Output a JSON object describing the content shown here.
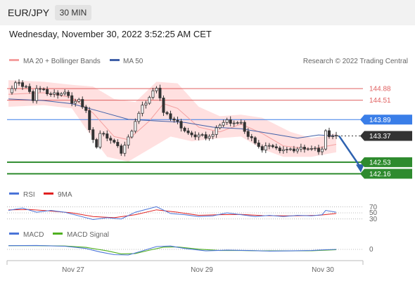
{
  "header": {
    "symbol": "EUR/JPY",
    "timeframe_label": "30 MIN",
    "timestamp": "Wednesday, November 30, 2022 3:52:25 AM CET"
  },
  "credit": "Research © 2022 Trading Central",
  "colors": {
    "price": "#333333",
    "bollinger": "#ffd6d6",
    "ma20": "#f4a0a0",
    "ma50": "#4060a8",
    "resistance": "#e06060",
    "pivot": "#3a7ee8",
    "support": "#2e8b2e",
    "current": "#333333",
    "rsi": "#4a74d8",
    "rsi_ma": "#e02020",
    "macd": "#4a74d8",
    "macd_signal": "#50b020",
    "projection_arrow": "#2e62b0"
  },
  "chart_data": [
    {
      "type": "candlestick",
      "title": "EUR/JPY",
      "interval": "30 MIN",
      "x_ticks": [
        "Nov 27",
        "Nov 29",
        "Nov 30"
      ],
      "ylim": [
        141.9,
        145.4
      ],
      "legend": [
        "MA 20 + Bollinger Bands",
        "MA 50"
      ],
      "current_price": 143.37,
      "current_price_label": "143.37",
      "levels": [
        {
          "name": "resistance-2",
          "value": 144.88,
          "label": "144.88",
          "role": "resistance",
          "tagged": false
        },
        {
          "name": "resistance-1",
          "value": 144.51,
          "label": "144.51",
          "role": "resistance",
          "tagged": false
        },
        {
          "name": "pivot",
          "value": 143.89,
          "label": "143.89",
          "role": "pivot",
          "tagged": true
        },
        {
          "name": "support-1",
          "value": 142.53,
          "label": "142.53",
          "role": "support",
          "tagged": true
        },
        {
          "name": "support-2",
          "value": 142.16,
          "label": "142.16",
          "role": "support",
          "tagged": true
        }
      ],
      "projection": {
        "from": 143.37,
        "to": 142.16,
        "direction": "down"
      },
      "close_path": [
        {
          "t": 0,
          "v": 144.75
        },
        {
          "t": 2,
          "v": 145.05
        },
        {
          "t": 5,
          "v": 144.95
        },
        {
          "t": 7,
          "v": 144.55
        },
        {
          "t": 8,
          "v": 144.9
        },
        {
          "t": 12,
          "v": 144.7
        },
        {
          "t": 16,
          "v": 144.75
        },
        {
          "t": 18,
          "v": 144.45
        },
        {
          "t": 20,
          "v": 144.5
        },
        {
          "t": 22,
          "v": 144.2
        },
        {
          "t": 23,
          "v": 143.55
        },
        {
          "t": 24,
          "v": 143.2
        },
        {
          "t": 25,
          "v": 143.05
        },
        {
          "t": 26,
          "v": 143.45
        },
        {
          "t": 28,
          "v": 143.35
        },
        {
          "t": 30,
          "v": 143.15
        },
        {
          "t": 32,
          "v": 142.85
        },
        {
          "t": 34,
          "v": 143.3
        },
        {
          "t": 36,
          "v": 143.85
        },
        {
          "t": 38,
          "v": 144.3
        },
        {
          "t": 40,
          "v": 144.6
        },
        {
          "t": 42,
          "v": 144.95
        },
        {
          "t": 43,
          "v": 144.6
        },
        {
          "t": 44,
          "v": 144.1
        },
        {
          "t": 46,
          "v": 143.95
        },
        {
          "t": 48,
          "v": 143.8
        },
        {
          "t": 50,
          "v": 143.55
        },
        {
          "t": 52,
          "v": 143.35
        },
        {
          "t": 54,
          "v": 143.4
        },
        {
          "t": 56,
          "v": 143.35
        },
        {
          "t": 58,
          "v": 143.4
        },
        {
          "t": 60,
          "v": 143.75
        },
        {
          "t": 62,
          "v": 143.85
        },
        {
          "t": 64,
          "v": 143.8
        },
        {
          "t": 66,
          "v": 143.75
        },
        {
          "t": 68,
          "v": 143.35
        },
        {
          "t": 70,
          "v": 143.2
        },
        {
          "t": 72,
          "v": 142.9
        },
        {
          "t": 74,
          "v": 143.1
        },
        {
          "t": 76,
          "v": 142.95
        },
        {
          "t": 78,
          "v": 142.95
        },
        {
          "t": 80,
          "v": 142.9
        },
        {
          "t": 82,
          "v": 142.95
        },
        {
          "t": 84,
          "v": 143.0
        },
        {
          "t": 86,
          "v": 142.95
        },
        {
          "t": 88,
          "v": 142.9
        },
        {
          "t": 89,
          "v": 142.95
        },
        {
          "t": 90,
          "v": 143.5
        },
        {
          "t": 91,
          "v": 143.4
        },
        {
          "t": 93,
          "v": 143.37
        }
      ],
      "ma20": [
        {
          "t": 0,
          "v": 144.7
        },
        {
          "t": 10,
          "v": 144.75
        },
        {
          "t": 18,
          "v": 144.6
        },
        {
          "t": 24,
          "v": 144.1
        },
        {
          "t": 30,
          "v": 143.35
        },
        {
          "t": 34,
          "v": 143.25
        },
        {
          "t": 40,
          "v": 143.85
        },
        {
          "t": 44,
          "v": 144.4
        },
        {
          "t": 48,
          "v": 144.25
        },
        {
          "t": 54,
          "v": 143.65
        },
        {
          "t": 60,
          "v": 143.5
        },
        {
          "t": 66,
          "v": 143.75
        },
        {
          "t": 72,
          "v": 143.45
        },
        {
          "t": 78,
          "v": 143.05
        },
        {
          "t": 86,
          "v": 142.95
        },
        {
          "t": 93,
          "v": 143.1
        }
      ],
      "ma50": [
        {
          "t": 0,
          "v": 144.55
        },
        {
          "t": 10,
          "v": 144.5
        },
        {
          "t": 18,
          "v": 144.4
        },
        {
          "t": 26,
          "v": 144.15
        },
        {
          "t": 34,
          "v": 143.9
        },
        {
          "t": 42,
          "v": 143.85
        },
        {
          "t": 50,
          "v": 143.8
        },
        {
          "t": 58,
          "v": 143.65
        },
        {
          "t": 66,
          "v": 143.6
        },
        {
          "t": 74,
          "v": 143.45
        },
        {
          "t": 82,
          "v": 143.3
        },
        {
          "t": 88,
          "v": 143.4
        },
        {
          "t": 93,
          "v": 143.37
        }
      ],
      "bollinger_upper": [
        {
          "t": 0,
          "v": 145.15
        },
        {
          "t": 10,
          "v": 145.1
        },
        {
          "t": 18,
          "v": 145.0
        },
        {
          "t": 24,
          "v": 144.95
        },
        {
          "t": 30,
          "v": 144.55
        },
        {
          "t": 36,
          "v": 144.45
        },
        {
          "t": 42,
          "v": 145.1
        },
        {
          "t": 48,
          "v": 145.05
        },
        {
          "t": 54,
          "v": 144.3
        },
        {
          "t": 60,
          "v": 144.0
        },
        {
          "t": 66,
          "v": 144.05
        },
        {
          "t": 72,
          "v": 143.95
        },
        {
          "t": 80,
          "v": 143.5
        },
        {
          "t": 86,
          "v": 143.3
        },
        {
          "t": 93,
          "v": 143.45
        }
      ],
      "bollinger_lower": [
        {
          "t": 0,
          "v": 144.3
        },
        {
          "t": 10,
          "v": 144.35
        },
        {
          "t": 18,
          "v": 144.25
        },
        {
          "t": 22,
          "v": 143.6
        },
        {
          "t": 28,
          "v": 142.7
        },
        {
          "t": 34,
          "v": 142.55
        },
        {
          "t": 40,
          "v": 142.95
        },
        {
          "t": 46,
          "v": 143.35
        },
        {
          "t": 52,
          "v": 143.2
        },
        {
          "t": 60,
          "v": 143.3
        },
        {
          "t": 66,
          "v": 143.35
        },
        {
          "t": 72,
          "v": 142.95
        },
        {
          "t": 78,
          "v": 142.7
        },
        {
          "t": 86,
          "v": 142.7
        },
        {
          "t": 93,
          "v": 142.85
        }
      ]
    },
    {
      "type": "line",
      "title": "RSI",
      "legend": [
        "RSI",
        "9MA"
      ],
      "levels": [
        70,
        50,
        30
      ],
      "level_labels": [
        "70",
        "50",
        "30"
      ],
      "ylim": [
        20,
        80
      ],
      "rsi": [
        {
          "t": 0,
          "v": 58
        },
        {
          "t": 4,
          "v": 66
        },
        {
          "t": 8,
          "v": 52
        },
        {
          "t": 12,
          "v": 58
        },
        {
          "t": 16,
          "v": 52
        },
        {
          "t": 20,
          "v": 40
        },
        {
          "t": 24,
          "v": 28
        },
        {
          "t": 28,
          "v": 34
        },
        {
          "t": 32,
          "v": 30
        },
        {
          "t": 36,
          "v": 52
        },
        {
          "t": 40,
          "v": 64
        },
        {
          "t": 42,
          "v": 70
        },
        {
          "t": 46,
          "v": 48
        },
        {
          "t": 50,
          "v": 44
        },
        {
          "t": 54,
          "v": 38
        },
        {
          "t": 58,
          "v": 40
        },
        {
          "t": 62,
          "v": 50
        },
        {
          "t": 66,
          "v": 44
        },
        {
          "t": 70,
          "v": 38
        },
        {
          "t": 74,
          "v": 42
        },
        {
          "t": 78,
          "v": 38
        },
        {
          "t": 82,
          "v": 42
        },
        {
          "t": 86,
          "v": 40
        },
        {
          "t": 89,
          "v": 44
        },
        {
          "t": 90,
          "v": 58
        },
        {
          "t": 93,
          "v": 52
        }
      ],
      "rsi_ma": [
        {
          "t": 0,
          "v": 60
        },
        {
          "t": 6,
          "v": 61
        },
        {
          "t": 12,
          "v": 56
        },
        {
          "t": 18,
          "v": 50
        },
        {
          "t": 24,
          "v": 38
        },
        {
          "t": 30,
          "v": 34
        },
        {
          "t": 36,
          "v": 44
        },
        {
          "t": 42,
          "v": 60
        },
        {
          "t": 48,
          "v": 52
        },
        {
          "t": 54,
          "v": 42
        },
        {
          "t": 60,
          "v": 44
        },
        {
          "t": 66,
          "v": 45
        },
        {
          "t": 72,
          "v": 41
        },
        {
          "t": 80,
          "v": 40
        },
        {
          "t": 88,
          "v": 42
        },
        {
          "t": 93,
          "v": 48
        }
      ]
    },
    {
      "type": "line",
      "title": "MACD",
      "legend": [
        "MACD",
        "MACD Signal"
      ],
      "zero_label": "0",
      "ylim": [
        -0.45,
        0.45
      ],
      "macd": [
        {
          "t": 0,
          "v": 0.2
        },
        {
          "t": 8,
          "v": 0.21
        },
        {
          "t": 16,
          "v": 0.17
        },
        {
          "t": 22,
          "v": 0.05
        },
        {
          "t": 26,
          "v": -0.14
        },
        {
          "t": 30,
          "v": -0.28
        },
        {
          "t": 34,
          "v": -0.3
        },
        {
          "t": 38,
          "v": -0.08
        },
        {
          "t": 42,
          "v": 0.15
        },
        {
          "t": 46,
          "v": 0.18
        },
        {
          "t": 50,
          "v": 0.05
        },
        {
          "t": 56,
          "v": -0.08
        },
        {
          "t": 62,
          "v": -0.04
        },
        {
          "t": 68,
          "v": -0.06
        },
        {
          "t": 74,
          "v": -0.09
        },
        {
          "t": 80,
          "v": -0.08
        },
        {
          "t": 86,
          "v": -0.06
        },
        {
          "t": 90,
          "v": -0.02
        },
        {
          "t": 93,
          "v": 0.0
        }
      ],
      "macd_signal": [
        {
          "t": 0,
          "v": 0.2
        },
        {
          "t": 8,
          "v": 0.2
        },
        {
          "t": 16,
          "v": 0.18
        },
        {
          "t": 22,
          "v": 0.11
        },
        {
          "t": 28,
          "v": -0.08
        },
        {
          "t": 32,
          "v": -0.24
        },
        {
          "t": 36,
          "v": -0.22
        },
        {
          "t": 40,
          "v": -0.04
        },
        {
          "t": 44,
          "v": 0.12
        },
        {
          "t": 48,
          "v": 0.13
        },
        {
          "t": 54,
          "v": 0.01
        },
        {
          "t": 60,
          "v": -0.06
        },
        {
          "t": 66,
          "v": -0.06
        },
        {
          "t": 72,
          "v": -0.08
        },
        {
          "t": 80,
          "v": -0.08
        },
        {
          "t": 86,
          "v": -0.07
        },
        {
          "t": 93,
          "v": -0.02
        }
      ]
    }
  ]
}
